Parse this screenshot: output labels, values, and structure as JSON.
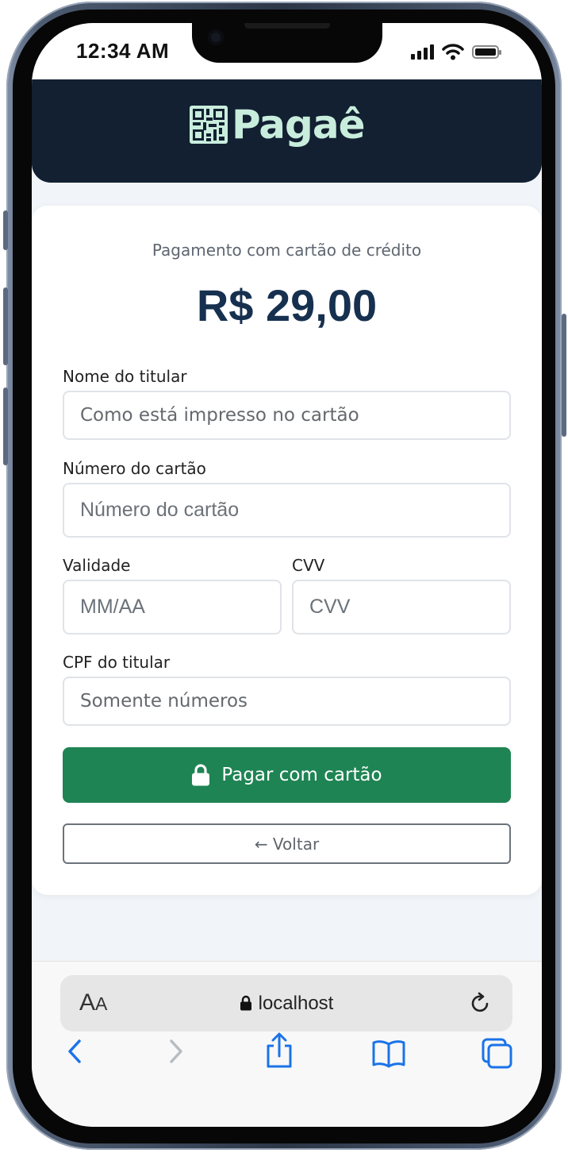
{
  "status": {
    "time": "12:34 AM"
  },
  "brand": {
    "name": "Pagaê"
  },
  "payment": {
    "subtitle": "Pagamento com cartão de crédito",
    "amount": "R$ 29,00"
  },
  "form": {
    "holder_label": "Nome do titular",
    "holder_placeholder": "Como está impresso no cartão",
    "number_label": "Número do cartão",
    "number_placeholder": "Número do cartão",
    "expiry_label": "Validade",
    "expiry_placeholder": "MM/AA",
    "cvv_label": "CVV",
    "cvv_placeholder": "CVV",
    "cpf_label": "CPF do titular",
    "cpf_placeholder": "Somente números",
    "pay_label": "Pagar com cartão",
    "back_label": "← Voltar"
  },
  "browser": {
    "aa_label_big": "A",
    "aa_label_small": "A",
    "url": "localhost"
  },
  "colors": {
    "header_bg": "#122032",
    "brand_text": "#c9eddc",
    "amount_text": "#16304f",
    "pay_button": "#1f8454",
    "ios_blue": "#1a73e8"
  },
  "icons": [
    "lock-icon",
    "reload-icon",
    "back-arrow-icon",
    "forward-arrow-icon",
    "share-icon",
    "bookmarks-icon",
    "tabs-icon",
    "qr-logo-icon",
    "signal-icon",
    "wifi-icon",
    "battery-icon"
  ]
}
